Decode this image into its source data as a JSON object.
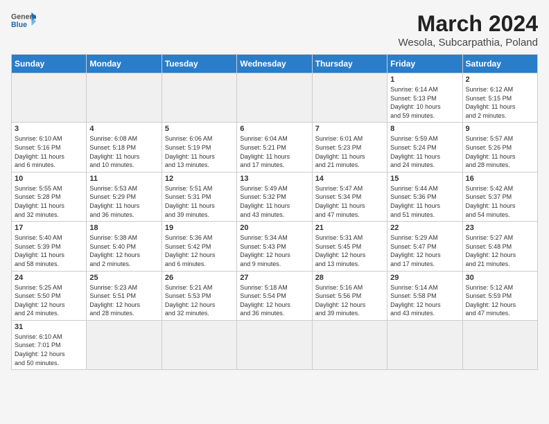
{
  "header": {
    "logo_general": "General",
    "logo_blue": "Blue",
    "month_year": "March 2024",
    "location": "Wesola, Subcarpathia, Poland"
  },
  "weekdays": [
    "Sunday",
    "Monday",
    "Tuesday",
    "Wednesday",
    "Thursday",
    "Friday",
    "Saturday"
  ],
  "weeks": [
    [
      {
        "day": "",
        "info": "",
        "empty": true
      },
      {
        "day": "",
        "info": "",
        "empty": true
      },
      {
        "day": "",
        "info": "",
        "empty": true
      },
      {
        "day": "",
        "info": "",
        "empty": true
      },
      {
        "day": "",
        "info": "",
        "empty": true
      },
      {
        "day": "1",
        "info": "Sunrise: 6:14 AM\nSunset: 5:13 PM\nDaylight: 10 hours\nand 59 minutes."
      },
      {
        "day": "2",
        "info": "Sunrise: 6:12 AM\nSunset: 5:15 PM\nDaylight: 11 hours\nand 2 minutes."
      }
    ],
    [
      {
        "day": "3",
        "info": "Sunrise: 6:10 AM\nSunset: 5:16 PM\nDaylight: 11 hours\nand 6 minutes."
      },
      {
        "day": "4",
        "info": "Sunrise: 6:08 AM\nSunset: 5:18 PM\nDaylight: 11 hours\nand 10 minutes."
      },
      {
        "day": "5",
        "info": "Sunrise: 6:06 AM\nSunset: 5:19 PM\nDaylight: 11 hours\nand 13 minutes."
      },
      {
        "day": "6",
        "info": "Sunrise: 6:04 AM\nSunset: 5:21 PM\nDaylight: 11 hours\nand 17 minutes."
      },
      {
        "day": "7",
        "info": "Sunrise: 6:01 AM\nSunset: 5:23 PM\nDaylight: 11 hours\nand 21 minutes."
      },
      {
        "day": "8",
        "info": "Sunrise: 5:59 AM\nSunset: 5:24 PM\nDaylight: 11 hours\nand 24 minutes."
      },
      {
        "day": "9",
        "info": "Sunrise: 5:57 AM\nSunset: 5:26 PM\nDaylight: 11 hours\nand 28 minutes."
      }
    ],
    [
      {
        "day": "10",
        "info": "Sunrise: 5:55 AM\nSunset: 5:28 PM\nDaylight: 11 hours\nand 32 minutes."
      },
      {
        "day": "11",
        "info": "Sunrise: 5:53 AM\nSunset: 5:29 PM\nDaylight: 11 hours\nand 36 minutes."
      },
      {
        "day": "12",
        "info": "Sunrise: 5:51 AM\nSunset: 5:31 PM\nDaylight: 11 hours\nand 39 minutes."
      },
      {
        "day": "13",
        "info": "Sunrise: 5:49 AM\nSunset: 5:32 PM\nDaylight: 11 hours\nand 43 minutes."
      },
      {
        "day": "14",
        "info": "Sunrise: 5:47 AM\nSunset: 5:34 PM\nDaylight: 11 hours\nand 47 minutes."
      },
      {
        "day": "15",
        "info": "Sunrise: 5:44 AM\nSunset: 5:36 PM\nDaylight: 11 hours\nand 51 minutes."
      },
      {
        "day": "16",
        "info": "Sunrise: 5:42 AM\nSunset: 5:37 PM\nDaylight: 11 hours\nand 54 minutes."
      }
    ],
    [
      {
        "day": "17",
        "info": "Sunrise: 5:40 AM\nSunset: 5:39 PM\nDaylight: 11 hours\nand 58 minutes."
      },
      {
        "day": "18",
        "info": "Sunrise: 5:38 AM\nSunset: 5:40 PM\nDaylight: 12 hours\nand 2 minutes."
      },
      {
        "day": "19",
        "info": "Sunrise: 5:36 AM\nSunset: 5:42 PM\nDaylight: 12 hours\nand 6 minutes."
      },
      {
        "day": "20",
        "info": "Sunrise: 5:34 AM\nSunset: 5:43 PM\nDaylight: 12 hours\nand 9 minutes."
      },
      {
        "day": "21",
        "info": "Sunrise: 5:31 AM\nSunset: 5:45 PM\nDaylight: 12 hours\nand 13 minutes."
      },
      {
        "day": "22",
        "info": "Sunrise: 5:29 AM\nSunset: 5:47 PM\nDaylight: 12 hours\nand 17 minutes."
      },
      {
        "day": "23",
        "info": "Sunrise: 5:27 AM\nSunset: 5:48 PM\nDaylight: 12 hours\nand 21 minutes."
      }
    ],
    [
      {
        "day": "24",
        "info": "Sunrise: 5:25 AM\nSunset: 5:50 PM\nDaylight: 12 hours\nand 24 minutes."
      },
      {
        "day": "25",
        "info": "Sunrise: 5:23 AM\nSunset: 5:51 PM\nDaylight: 12 hours\nand 28 minutes."
      },
      {
        "day": "26",
        "info": "Sunrise: 5:21 AM\nSunset: 5:53 PM\nDaylight: 12 hours\nand 32 minutes."
      },
      {
        "day": "27",
        "info": "Sunrise: 5:18 AM\nSunset: 5:54 PM\nDaylight: 12 hours\nand 36 minutes."
      },
      {
        "day": "28",
        "info": "Sunrise: 5:16 AM\nSunset: 5:56 PM\nDaylight: 12 hours\nand 39 minutes."
      },
      {
        "day": "29",
        "info": "Sunrise: 5:14 AM\nSunset: 5:58 PM\nDaylight: 12 hours\nand 43 minutes."
      },
      {
        "day": "30",
        "info": "Sunrise: 5:12 AM\nSunset: 5:59 PM\nDaylight: 12 hours\nand 47 minutes."
      }
    ],
    [
      {
        "day": "31",
        "info": "Sunrise: 6:10 AM\nSunset: 7:01 PM\nDaylight: 12 hours\nand 50 minutes."
      },
      {
        "day": "",
        "info": "",
        "empty": true
      },
      {
        "day": "",
        "info": "",
        "empty": true
      },
      {
        "day": "",
        "info": "",
        "empty": true
      },
      {
        "day": "",
        "info": "",
        "empty": true
      },
      {
        "day": "",
        "info": "",
        "empty": true
      },
      {
        "day": "",
        "info": "",
        "empty": true
      }
    ]
  ]
}
